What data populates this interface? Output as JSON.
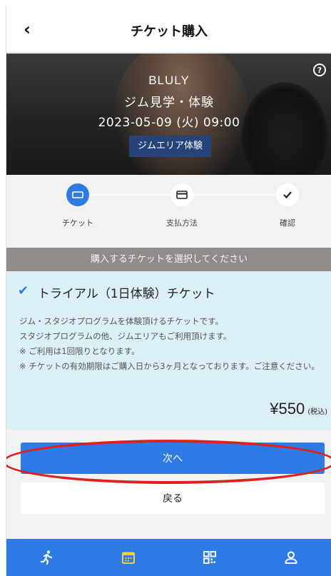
{
  "header": {
    "title": "チケット購入",
    "back_icon": "chevron-left-icon"
  },
  "hero": {
    "gym_name": "BLULY",
    "program": "ジム見学・体験",
    "datetime": "2023-05-09 (火) 09:00",
    "badge": "ジムエリア体験",
    "help_icon": "question-circle-icon"
  },
  "stepper": {
    "steps": [
      {
        "label": "チケット",
        "icon": "ticket-icon",
        "active": true
      },
      {
        "label": "支払方法",
        "icon": "credit-card-icon",
        "active": false
      },
      {
        "label": "確認",
        "icon": "check-icon",
        "active": false
      }
    ]
  },
  "banner": {
    "text": "購入するチケットを選択してください"
  },
  "ticket": {
    "name": "トライアル（1日体験）チケット",
    "description": [
      "ジム・スタジオプログラムを体験頂けるチケットです。",
      "スタジオプログラムの他、ジムエリアもご利用頂けます。",
      "※ ご利用は1回限りとなります。",
      "※ チケットの有効期限はご購入日から3ヶ月となっております。ご注意ください。"
    ],
    "price": "¥550",
    "tax_note": "(税込)",
    "selected": true
  },
  "buttons": {
    "next": "次へ",
    "back": "戻る"
  },
  "tabbar": {
    "tabs": [
      {
        "icon": "running-icon",
        "active": false
      },
      {
        "icon": "calendar-icon",
        "active": true
      },
      {
        "icon": "qr-code-icon",
        "active": false
      },
      {
        "icon": "user-icon",
        "active": false
      }
    ]
  },
  "colors": {
    "accent": "#2f7be6",
    "highlight": "#e0201c",
    "ticket_bg": "#dbeff6",
    "banner_bg": "#8f8c89"
  }
}
